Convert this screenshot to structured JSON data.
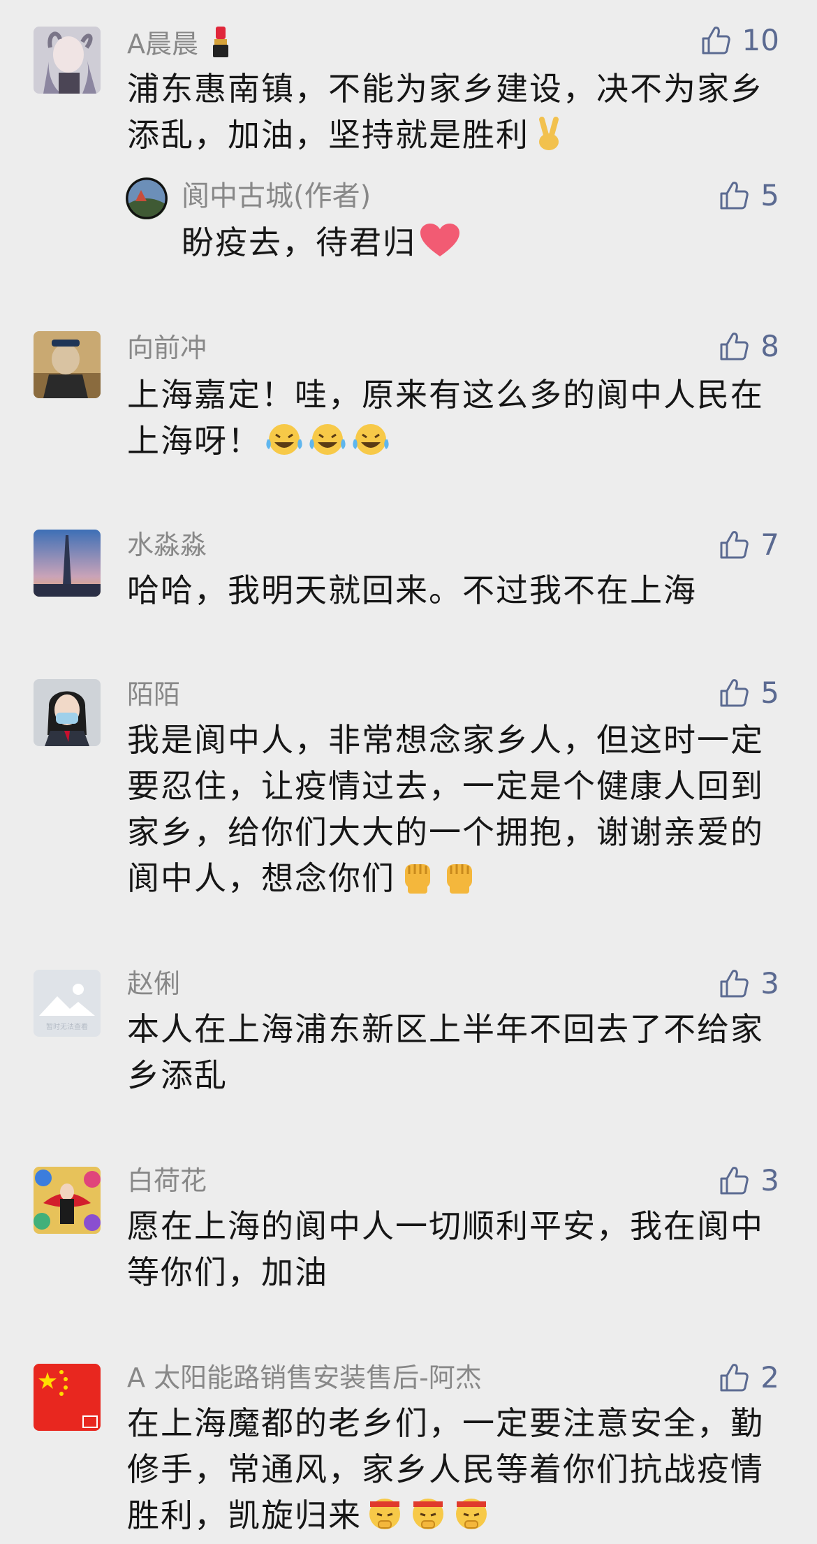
{
  "colors": {
    "background": "#ededed",
    "name": "#888888",
    "text": "#161616",
    "like": "#5b6a91"
  },
  "comments": [
    {
      "name": "A晨晨",
      "name_emoji": "lipstick-emoji",
      "likes": "10",
      "text": "浦东惠南镇，不能为家乡建设，决不为家乡添乱，加油，坚持就是胜利",
      "text_emojis": [
        "victory-hand-emoji"
      ],
      "reply": {
        "name": "阆中古城(作者)",
        "likes": "5",
        "text": "盼疫去，待君归",
        "text_emojis": [
          "heart-emoji"
        ]
      }
    },
    {
      "name": "向前冲",
      "likes": "8",
      "text": "上海嘉定！哇，原来有这么多的阆中人民在上海呀！",
      "text_emojis": [
        "tears-of-joy-emoji",
        "tears-of-joy-emoji",
        "tears-of-joy-emoji"
      ]
    },
    {
      "name": "水淼淼",
      "likes": "7",
      "text": "哈哈，我明天就回来。不过我不在上海",
      "text_emojis": []
    },
    {
      "name": "陌陌",
      "likes": "5",
      "text": "我是阆中人，非常想念家乡人，但这时一定要忍住，让疫情过去，一定是个健康人回到家乡，给你们大大的一个拥抱，谢谢亲爱的阆中人，想念你们",
      "text_emojis": [
        "raised-fist-emoji",
        "raised-fist-emoji"
      ]
    },
    {
      "name": "赵俐",
      "likes": "3",
      "avatar_caption": "暂时无法查看",
      "text": "本人在上海浦东新区上半年不回去了不给家乡添乱",
      "text_emojis": []
    },
    {
      "name": "白荷花",
      "likes": "3",
      "text": "愿在上海的阆中人一切顺利平安，我在阆中等你们，加油",
      "text_emojis": []
    },
    {
      "name": "A 太阳能路销售安装售后-阿杰",
      "likes": "2",
      "text": "在上海魔都的老乡们，一定要注意安全，勤修手，常通风，家乡人民等着你们抗战疫情胜利，凯旋归来",
      "text_emojis": [
        "fighting-face-emoji",
        "fighting-face-emoji",
        "fighting-face-emoji"
      ]
    }
  ]
}
